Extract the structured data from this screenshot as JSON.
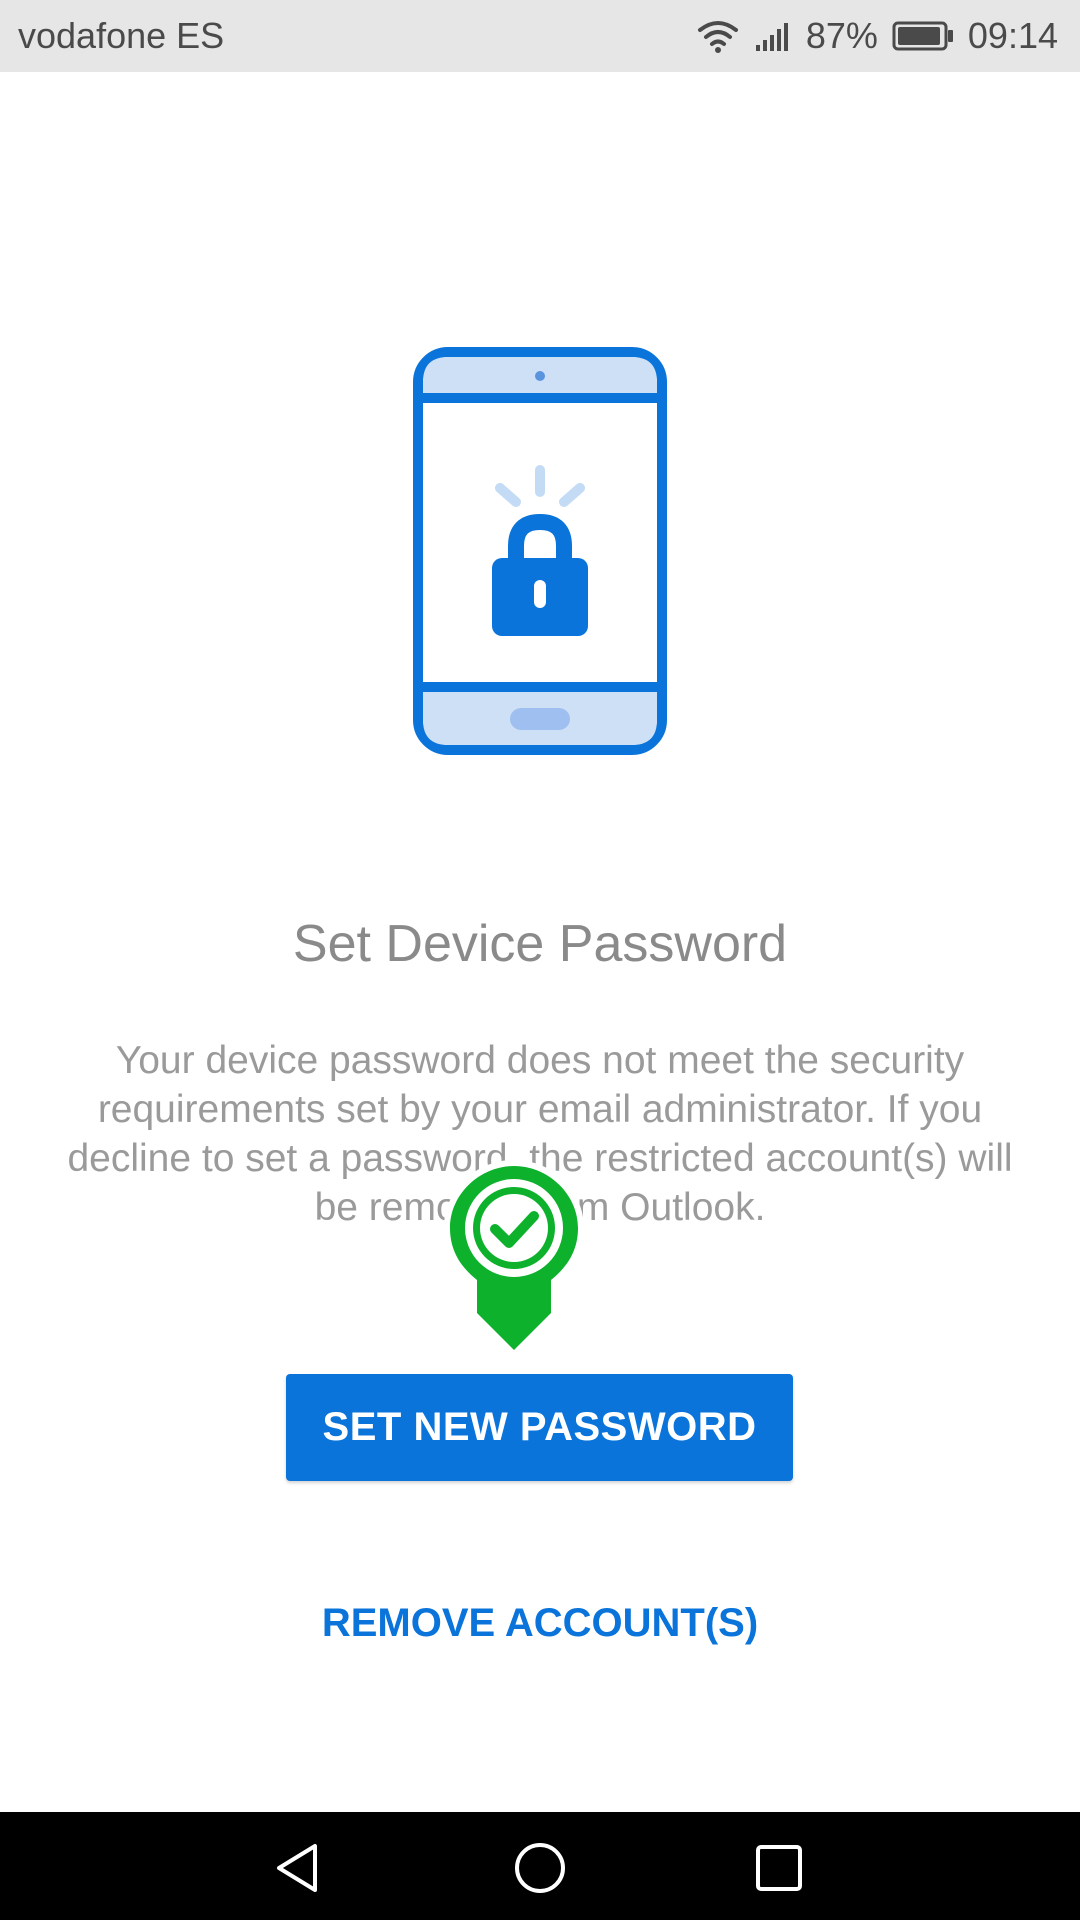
{
  "status_bar": {
    "carrier": "vodafone ES",
    "battery_percent": "87%",
    "time": "09:14",
    "icons": [
      "wifi-icon",
      "signal-icon",
      "battery-icon"
    ]
  },
  "illustration": {
    "icons": [
      "phone-icon",
      "lock-icon"
    ]
  },
  "title": "Set Device Password",
  "message": "Your device password does not meet the security requirements set by your email administrator. If you decline to set a password, the restricted account(s) will be removed from Outlook.",
  "buttons": {
    "primary_label": "SET NEW PASSWORD",
    "secondary_label": "REMOVE ACCOUNT(S)"
  },
  "marker": {
    "icon": "check-marker-icon"
  },
  "nav_bar": {
    "icons": [
      "back-icon",
      "home-icon",
      "recent-apps-icon"
    ]
  },
  "colors": {
    "accent": "#0a74da",
    "marker_green": "#0db12b"
  }
}
